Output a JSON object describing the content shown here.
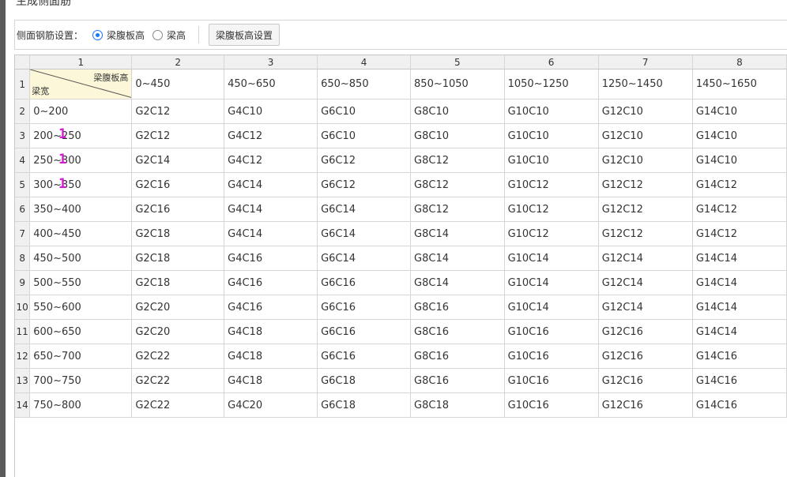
{
  "title": "生成侧面筋",
  "settings": {
    "label": "侧面钢筋设置：",
    "options": [
      {
        "label": "梁腹板高",
        "checked": true
      },
      {
        "label": "梁高",
        "checked": false
      }
    ],
    "button_label": "梁腹板高设置"
  },
  "grid": {
    "column_numbers": [
      "1",
      "2",
      "3",
      "4",
      "5",
      "6",
      "7",
      "8"
    ],
    "corner_top": "梁腹板高",
    "corner_bottom": "梁宽",
    "header_values": [
      "0~450",
      "450~650",
      "650~850",
      "850~1050",
      "1050~1250",
      "1250~1450",
      "1450~1650"
    ],
    "rows": [
      {
        "num": "2",
        "width": "0~200",
        "cells": [
          "G2C12",
          "G4C10",
          "G6C10",
          "G8C10",
          "G10C10",
          "G12C10",
          "G14C10"
        ]
      },
      {
        "num": "3",
        "width": "200~250",
        "cells": [
          "G2C12",
          "G4C12",
          "G6C10",
          "G8C10",
          "G10C10",
          "G12C10",
          "G14C10"
        ]
      },
      {
        "num": "4",
        "width": "250~300",
        "cells": [
          "G2C14",
          "G4C12",
          "G6C12",
          "G8C12",
          "G10C10",
          "G12C10",
          "G14C10"
        ]
      },
      {
        "num": "5",
        "width": "300~350",
        "cells": [
          "G2C16",
          "G4C14",
          "G6C12",
          "G8C12",
          "G10C12",
          "G12C12",
          "G14C12"
        ]
      },
      {
        "num": "6",
        "width": "350~400",
        "cells": [
          "G2C16",
          "G4C14",
          "G6C14",
          "G8C12",
          "G10C12",
          "G12C12",
          "G14C12"
        ]
      },
      {
        "num": "7",
        "width": "400~450",
        "cells": [
          "G2C18",
          "G4C14",
          "G6C14",
          "G8C14",
          "G10C12",
          "G12C12",
          "G14C12"
        ]
      },
      {
        "num": "8",
        "width": "450~500",
        "cells": [
          "G2C18",
          "G4C16",
          "G6C14",
          "G8C14",
          "G10C14",
          "G12C14",
          "G14C14"
        ]
      },
      {
        "num": "9",
        "width": "500~550",
        "cells": [
          "G2C18",
          "G4C16",
          "G6C16",
          "G8C14",
          "G10C14",
          "G12C14",
          "G14C14"
        ]
      },
      {
        "num": "10",
        "width": "550~600",
        "cells": [
          "G2C20",
          "G4C16",
          "G6C16",
          "G8C16",
          "G10C14",
          "G12C14",
          "G14C14"
        ]
      },
      {
        "num": "11",
        "width": "600~650",
        "cells": [
          "G2C20",
          "G4C18",
          "G6C16",
          "G8C16",
          "G10C16",
          "G12C16",
          "G14C14"
        ]
      },
      {
        "num": "12",
        "width": "650~700",
        "cells": [
          "G2C22",
          "G4C18",
          "G6C16",
          "G8C16",
          "G10C16",
          "G12C16",
          "G14C16"
        ]
      },
      {
        "num": "13",
        "width": "700~750",
        "cells": [
          "G2C22",
          "G4C18",
          "G6C18",
          "G8C16",
          "G10C16",
          "G12C16",
          "G14C16"
        ]
      },
      {
        "num": "14",
        "width": "750~800",
        "cells": [
          "G2C22",
          "G4C20",
          "G6C18",
          "G8C18",
          "G10C16",
          "G12C16",
          "G14C16"
        ]
      }
    ],
    "markers": [
      "1",
      "1",
      "1"
    ]
  }
}
